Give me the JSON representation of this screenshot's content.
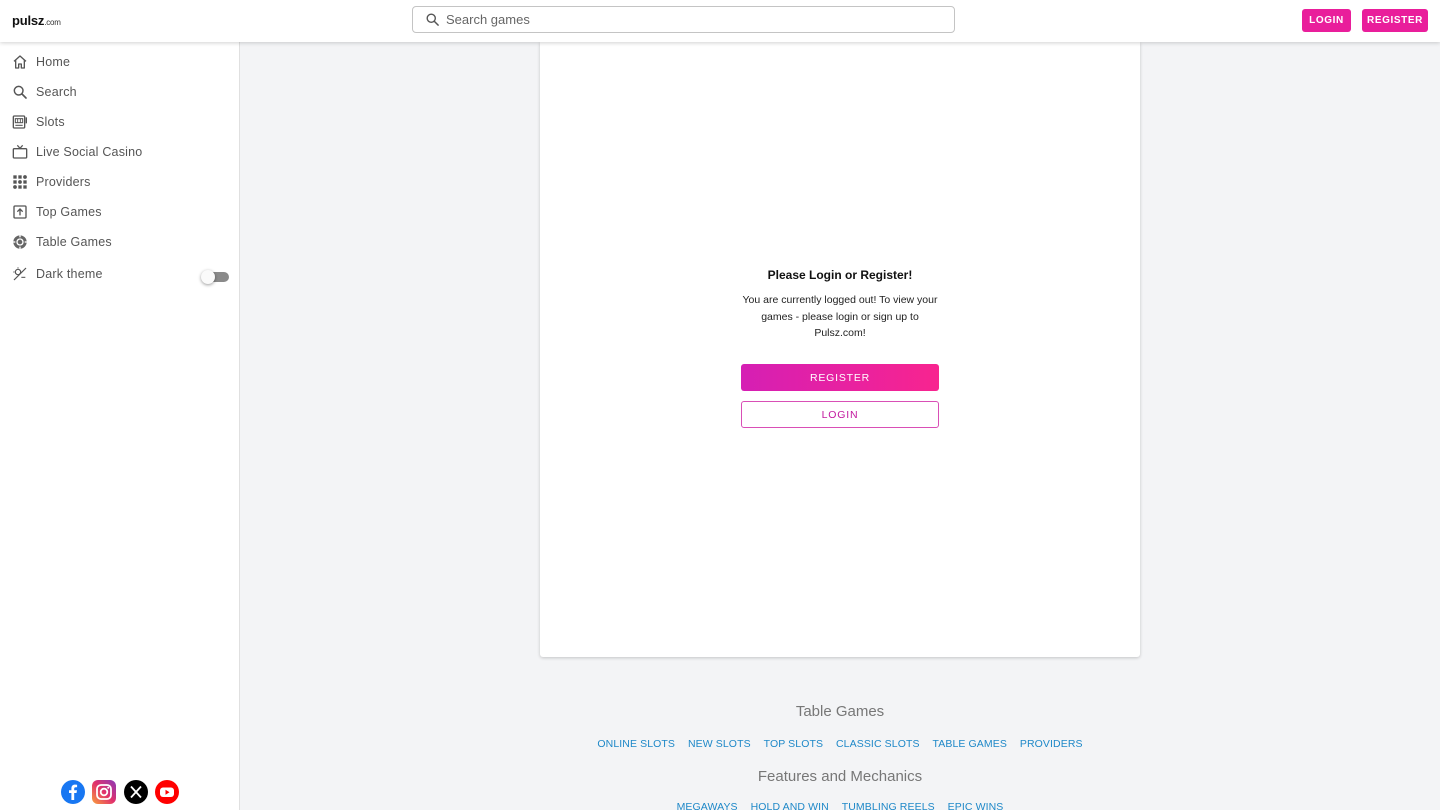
{
  "header": {
    "logo_main": "pulsz",
    "logo_suffix": ".com",
    "search_placeholder": "Search games",
    "login_label": "LOGIN",
    "register_label": "REGISTER"
  },
  "sidebar": {
    "items": [
      {
        "label": "Home",
        "icon": "home-icon"
      },
      {
        "label": "Search",
        "icon": "search-icon"
      },
      {
        "label": "Slots",
        "icon": "slots-icon"
      },
      {
        "label": "Live Social Casino",
        "icon": "tv-icon"
      },
      {
        "label": "Providers",
        "icon": "grid-icon"
      },
      {
        "label": "Top Games",
        "icon": "arrow-up-box-icon"
      },
      {
        "label": "Table Games",
        "icon": "chip-icon"
      }
    ],
    "dark_theme_label": "Dark theme",
    "dark_theme_on": false,
    "social": [
      "facebook-icon",
      "instagram-icon",
      "x-icon",
      "youtube-icon"
    ]
  },
  "card": {
    "title": "Please Login or Register!",
    "text": "You are currently logged out! To view your games - please login or sign up to Pulsz.com!",
    "register_label": "REGISTER",
    "login_label": "LOGIN"
  },
  "footer": {
    "section1_title": "Table Games",
    "section1_links": [
      "ONLINE SLOTS",
      "NEW SLOTS",
      "TOP SLOTS",
      "CLASSIC SLOTS",
      "TABLE GAMES",
      "PROVIDERS"
    ],
    "section2_title": "Features and Mechanics",
    "section2_links": [
      "MEGAWAYS",
      "HOLD AND WIN",
      "TUMBLING REELS",
      "EPIC WINS"
    ]
  },
  "colors": {
    "accent": "#e91e9b",
    "link": "#1e88c8"
  }
}
